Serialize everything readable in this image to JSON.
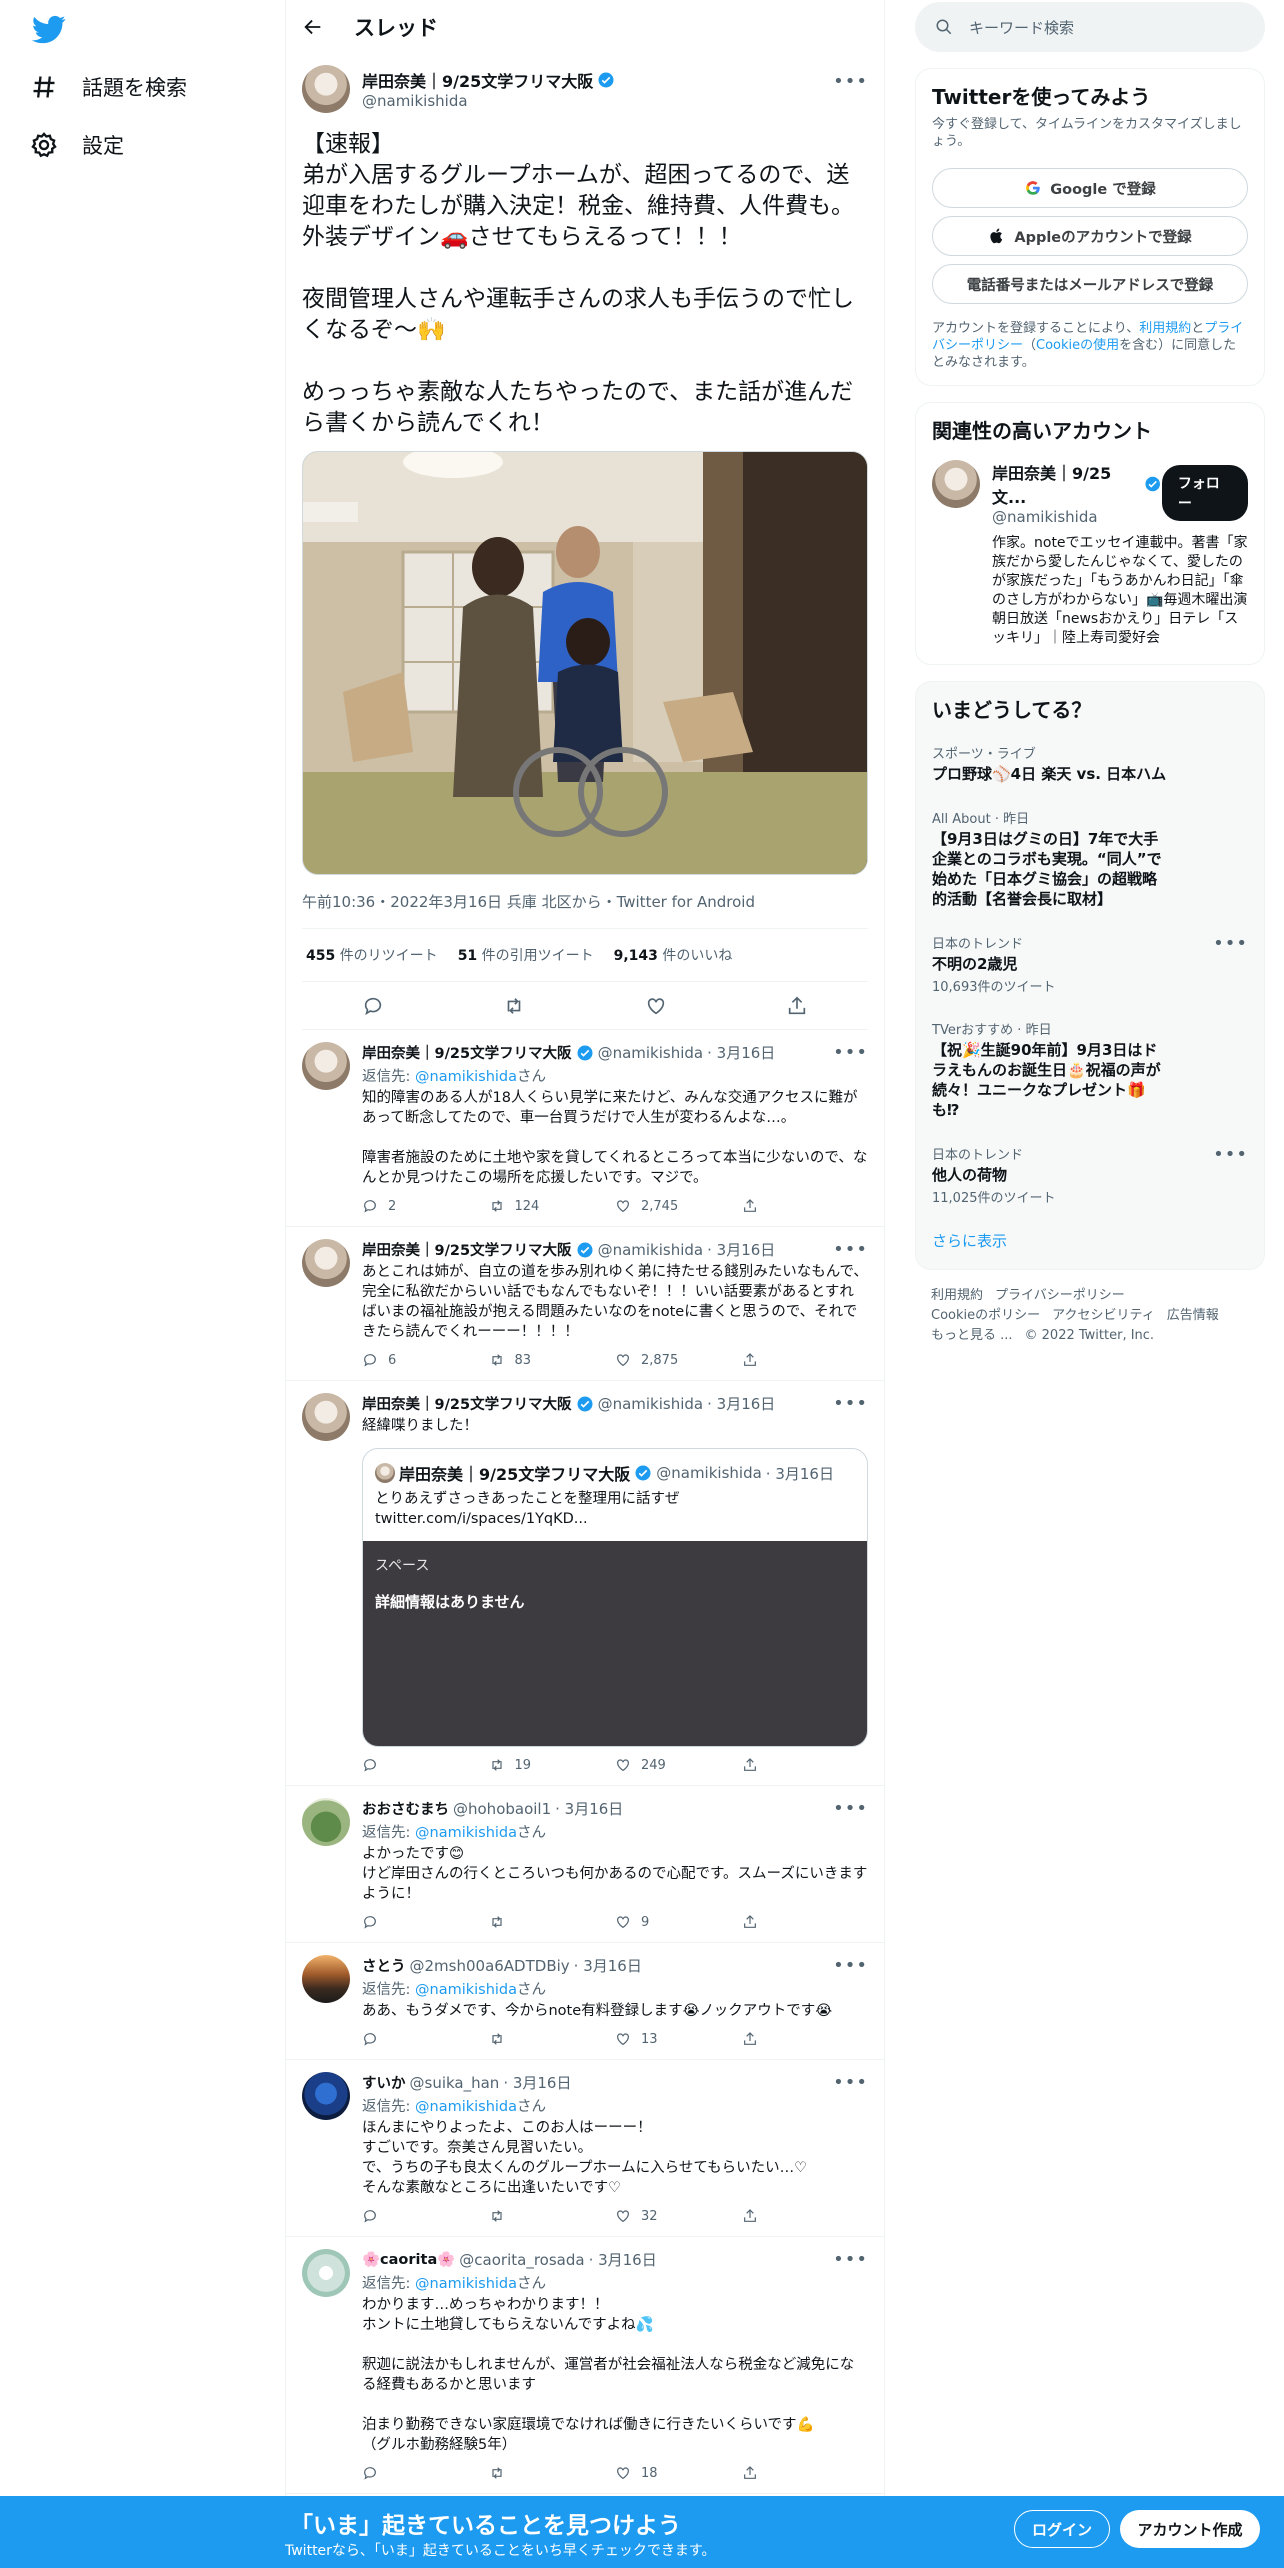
{
  "colors": {
    "accent": "#1d9bf0",
    "text": "#0f1419",
    "secondary": "#536471",
    "border": "#eff3f4"
  },
  "nav": {
    "explore": "話題を検索",
    "settings": "設定"
  },
  "header": {
    "title": "スレッド"
  },
  "main_tweet": {
    "name": "岸田奈美｜9/25文学フリマ大阪",
    "handle": "@namikishida",
    "text": "【速報】\n弟が入居するグループホームが、超困ってるので、送迎車をわたしが購入決定！税金、維持費、人件費も。外装デザイン🚗させてもらえるって！！！\n\n夜間管理人さんや運転手さんの求人も手伝うので忙しくなるぞ〜🙌\n\nめっっちゃ素敵な人たちやったので、また話が進んだら書くから読んでくれ！",
    "meta": "午前10:36・2022年3月16日 兵庫 北区から・Twitter for Android",
    "retweets": "455",
    "retweets_label": "件のリツイート",
    "quotes": "51",
    "quotes_label": "件の引用ツイート",
    "likes": "9,143",
    "likes_label": "件のいいね"
  },
  "replies": [
    {
      "name": "岸田奈美｜9/25文学フリマ大阪",
      "handle": "@namikishida",
      "date": "· 3月16日",
      "reply_prefix": "返信先: ",
      "reply_to": "@namikishida",
      "reply_suffix": "さん",
      "text": "知的障害のある人が18人くらい見学に来たけど、みんな交通アクセスに難があって断念してたので、車一台買うだけで人生が変わるんよな…。\n\n障害者施設のために土地や家を貸してくれるところって本当に少ないので、なんとか見つけたこの場所を応援したいです。マジで。",
      "replies": "2",
      "retweets": "124",
      "likes": "2,745"
    },
    {
      "name": "岸田奈美｜9/25文学フリマ大阪",
      "handle": "@namikishida",
      "date": "· 3月16日",
      "text": "あとこれは姉が、自立の道を歩み別れゆく弟に持たせる餞別みたいなもんで、完全に私欲だからいい話でもなんでもないぞ！！！いい話要素があるとすればいまの福祉施設が抱える問題みたいなのをnoteに書くと思うので、それできたら読んでくれーーー！！！！",
      "replies": "6",
      "retweets": "83",
      "likes": "2,875"
    },
    {
      "name": "岸田奈美｜9/25文学フリマ大阪",
      "handle": "@namikishida",
      "date": "· 3月16日",
      "text": "経緯喋りました！",
      "quote": {
        "name": "岸田奈美｜9/25文学フリマ大阪",
        "handle": "@namikishida",
        "date": "· 3月16日",
        "text": "とりあえずさっきあったことを整理用に話すぜ\ntwitter.com/i/spaces/1YqKD...",
        "space_label": "スペース",
        "space_detail": "詳細情報はありません"
      },
      "retweets": "19",
      "likes": "249"
    },
    {
      "name": "おおさむまち",
      "handle": "@hohobaoil1",
      "date": "· 3月16日",
      "reply_prefix": "返信先: ",
      "reply_to": "@namikishida",
      "reply_suffix": "さん",
      "text": "よかったです😊\nけど岸田さんの行くところいつも何かあるので心配です。スムーズにいきますように！",
      "likes": "9"
    },
    {
      "name": "さとう",
      "handle": "@2msh00a6ADTDBiy",
      "date": "· 3月16日",
      "reply_prefix": "返信先: ",
      "reply_to": "@namikishida",
      "reply_suffix": "さん",
      "text": "ああ、もうダメです、今からnote有料登録します😭ノックアウトです😭",
      "likes": "13"
    },
    {
      "name": "すいか",
      "handle": "@suika_han",
      "date": "· 3月16日",
      "reply_prefix": "返信先: ",
      "reply_to": "@namikishida",
      "reply_suffix": "さん",
      "text": "ほんまにやりよったよ、このお人はーーー！\nすごいです。奈美さん見習いたい。\nで、うちの子も良太くんのグループホームに入らせてもらいたい…♡\nそんな素敵なところに出逢いたいです♡",
      "likes": "32"
    },
    {
      "name": "🌸caorita🌸",
      "handle": "@caorita_rosada",
      "date": "· 3月16日",
      "reply_prefix": "返信先: ",
      "reply_to": "@namikishida",
      "reply_suffix": "さん",
      "text": "わかります…めっちゃわかります！！\nホントに土地貸してもらえないんですよね💦\n\n釈迦に説法かもしれませんが、運営者が社会福祉法人なら税金など減免になる経費もあるかと思います\n\n泊まり勤務できない家庭環境でなければ働きに行きたいくらいです💪\n（グルホ勤務経験5年）",
      "likes": "18"
    }
  ],
  "right": {
    "search_placeholder": "キーワード検索",
    "signup": {
      "title": "Twitterを使ってみよう",
      "subtitle": "今すぐ登録して、タイムラインをカスタマイズしましょう。",
      "google": "Google で登録",
      "apple": "Appleのアカウントで登録",
      "phone": "電話番号またはメールアドレスで登録",
      "terms_prefix": "アカウントを登録することにより、",
      "terms_link1": "利用規約",
      "terms_and": "と",
      "terms_link2": "プライバシーポリシー",
      "terms_paren_open": "（",
      "terms_link3": "Cookieの使用",
      "terms_suffix": "を含む）に同意したとみなされます。"
    },
    "related": {
      "title": "関連性の高いアカウント",
      "name": "岸田奈美｜9/25文...",
      "handle": "@namikishida",
      "follow": "フォロー",
      "bio": "作家。noteでエッセイ連載中。著書「家族だから愛したんじゃなくて、愛したのが家族だった」「もうあかんわ日記」「傘のさし方がわからない」📺毎週木曜出演 朝日放送「newsおかえり」日テレ「スッキリ」｜陸上寿司愛好会"
    },
    "trends": {
      "title": "いまどうしてる？",
      "items": [
        {
          "context": "スポーツ・ライブ",
          "name": "プロ野球⚾4日 楽天 vs. 日本ハム",
          "count": ""
        },
        {
          "context": "All About · 昨日",
          "name": "【9月3日はグミの日】7年で大手企業とのコラボも実現。“同人”で始めた「日本グミ協会」の超戦略的活動【名誉会長に取材】",
          "count": ""
        },
        {
          "context": "日本のトレンド",
          "name": "不明の2歳児",
          "count": "10,693件のツイート"
        },
        {
          "context": "TVerおすすめ · 昨日",
          "name": "【祝🎉生誕90年前】9月3日はドラえもんのお誕生日🎂祝福の声が続々！ユニークなプレゼント🎁も⁉",
          "count": ""
        },
        {
          "context": "日本のトレンド",
          "name": "他人の荷物",
          "count": "11,025件のツイート"
        }
      ],
      "show_more": "さらに表示"
    },
    "footer": {
      "terms": "利用規約",
      "privacy": "プライバシーポリシー",
      "cookie": "Cookieのポリシー",
      "accessibility": "アクセシビリティ",
      "ads": "広告情報",
      "more": "もっと見る ...",
      "copyright": "© 2022 Twitter, Inc."
    }
  },
  "banner": {
    "title": "「いま」起きていることを見つけよう",
    "subtitle": "Twitterなら、「いま」起きていることをいち早くチェックできます。",
    "login": "ログイン",
    "signup": "アカウント作成"
  }
}
